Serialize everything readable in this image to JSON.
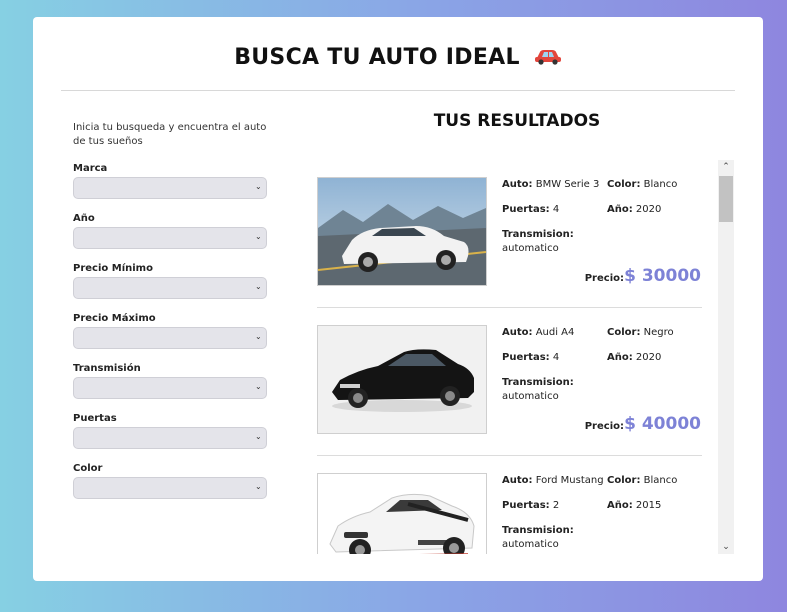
{
  "header": {
    "title": "BUSCA TU AUTO IDEAL",
    "icon": "car-icon"
  },
  "sidebar": {
    "intro": "Inicia tu busqueda y encuentra el auto de tus sueños",
    "filters": [
      {
        "label": "Marca",
        "value": ""
      },
      {
        "label": "Año",
        "value": ""
      },
      {
        "label": "Precio Mínimo",
        "value": ""
      },
      {
        "label": "Precio Máximo",
        "value": ""
      },
      {
        "label": "Transmisión",
        "value": ""
      },
      {
        "label": "Puertas",
        "value": ""
      },
      {
        "label": "Color",
        "value": ""
      }
    ]
  },
  "results": {
    "title": "TUS RESULTADOS",
    "labels": {
      "auto": "Auto:",
      "color": "Color:",
      "puertas": "Puertas:",
      "anio": "Año:",
      "transmision": "Transmision:",
      "precio": "Precio:"
    },
    "items": [
      {
        "auto": "BMW Serie 3",
        "color": "Blanco",
        "puertas": "4",
        "anio": "2020",
        "transmision": "automatico",
        "precio": "$ 30000",
        "car_color": "#f2f2f2",
        "bg": "scenic"
      },
      {
        "auto": "Audi A4",
        "color": "Negro",
        "puertas": "4",
        "anio": "2020",
        "transmision": "automatico",
        "precio": "$ 40000",
        "car_color": "#141414",
        "bg": "studio"
      },
      {
        "auto": "Ford Mustang",
        "color": "Blanco",
        "puertas": "2",
        "anio": "2015",
        "transmision": "automatico",
        "precio": "",
        "car_color": "#f4f4f4",
        "bg": "white"
      }
    ]
  },
  "colors": {
    "accent": "#7d82d6",
    "card": "#ffffff"
  }
}
